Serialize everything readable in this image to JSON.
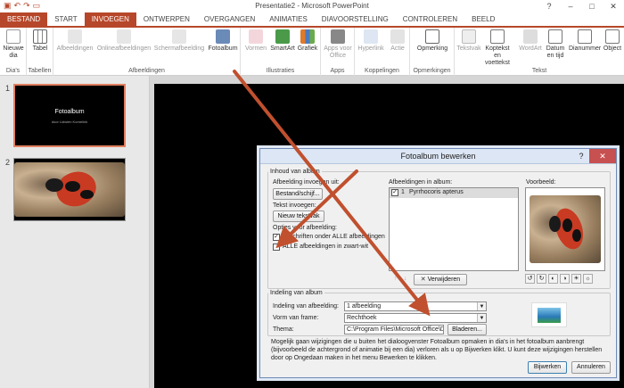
{
  "window": {
    "title": "Presentatie2 - Microsoft PowerPoint",
    "controls": [
      "?",
      "–",
      "□",
      "✕"
    ]
  },
  "qat": [
    "save-icon",
    "undo-icon",
    "redo-icon",
    "slideshow-icon"
  ],
  "tabs": [
    "BESTAND",
    "START",
    "INVOEGEN",
    "ONTWERPEN",
    "OVERGANGEN",
    "ANIMATIES",
    "DIAVOORSTELLING",
    "CONTROLEREN",
    "BEELD"
  ],
  "ribbon": {
    "groups": [
      {
        "label": "Dia's",
        "buttons": [
          "Nieuwe dia"
        ]
      },
      {
        "label": "Tabellen",
        "buttons": [
          "Tabel"
        ]
      },
      {
        "label": "Afbeeldingen",
        "buttons": [
          "Afbeeldingen",
          "Onlineafbeeldingen",
          "Schermafbeelding",
          "Fotoalbum"
        ]
      },
      {
        "label": "Illustraties",
        "buttons": [
          "Vormen",
          "SmartArt",
          "Grafiek"
        ]
      },
      {
        "label": "Apps",
        "buttons": [
          "Apps voor Office"
        ]
      },
      {
        "label": "Koppelingen",
        "buttons": [
          "Hyperlink",
          "Actie"
        ]
      },
      {
        "label": "Opmerkingen",
        "buttons": [
          "Opmerking"
        ]
      },
      {
        "label": "Tekst",
        "buttons": [
          "Tekstvak",
          "Koptekst en voettekst",
          "WordArt",
          "Datum en tijd",
          "Dianummer",
          "Object"
        ]
      }
    ]
  },
  "slides": [
    {
      "number": "1",
      "title": "Fotoalbum",
      "subtitle": "door Lidwien Kornelink"
    },
    {
      "number": "2"
    }
  ],
  "dialog": {
    "title": "Fotoalbum bewerken",
    "help": "?",
    "close": "✕",
    "album_content": "Inhoud van album",
    "insert_from": "Afbeelding invoegen uit:",
    "file_disk_button": "Bestand/schijf...",
    "insert_text": "Tekst invoegen:",
    "new_textbox_button": "Nieuw tekstvak",
    "options": "Opties voor afbeelding:",
    "captions_label": "Bijschriften onder ALLE afbeeldingen",
    "captions_checked": true,
    "bw_label": "ALLE afbeeldingen in zwart-wit",
    "bw_checked": false,
    "pictures_in_album": "Afbeeldingen in album:",
    "album_items": [
      {
        "index": "1",
        "name": "Pyrrhocoris apterus",
        "checked": true
      }
    ],
    "preview": "Voorbeeld:",
    "remove_button": "Verwijderen",
    "layout_section": "Indeling van album",
    "picture_layout_label": "Indeling van afbeelding:",
    "picture_layout_value": "1 afbeelding",
    "frame_shape_label": "Vorm van frame:",
    "frame_shape_value": "Rechthoek",
    "theme_label": "Thema:",
    "theme_value": "C:\\Program Files\\Microsoft Office\\D",
    "browse_button": "Bladeren...",
    "note": "Mogelijk gaan wijzigingen die u buiten het dialoogvenster Fotoalbum opmaken in dia's in het fotoalbum aanbrengt (bijvoorbeeld de achtergrond of animatie bij een dia) verloren als u op Bijwerken klikt. U kunt deze wijzigingen herstellen door op Ongedaan maken in het menu Bewerken te klikken.",
    "update_button": "Bijwerken",
    "cancel_button": "Annuleren"
  },
  "colors": {
    "accent": "#b7472a",
    "annotation_arrow": "#c0502e"
  }
}
